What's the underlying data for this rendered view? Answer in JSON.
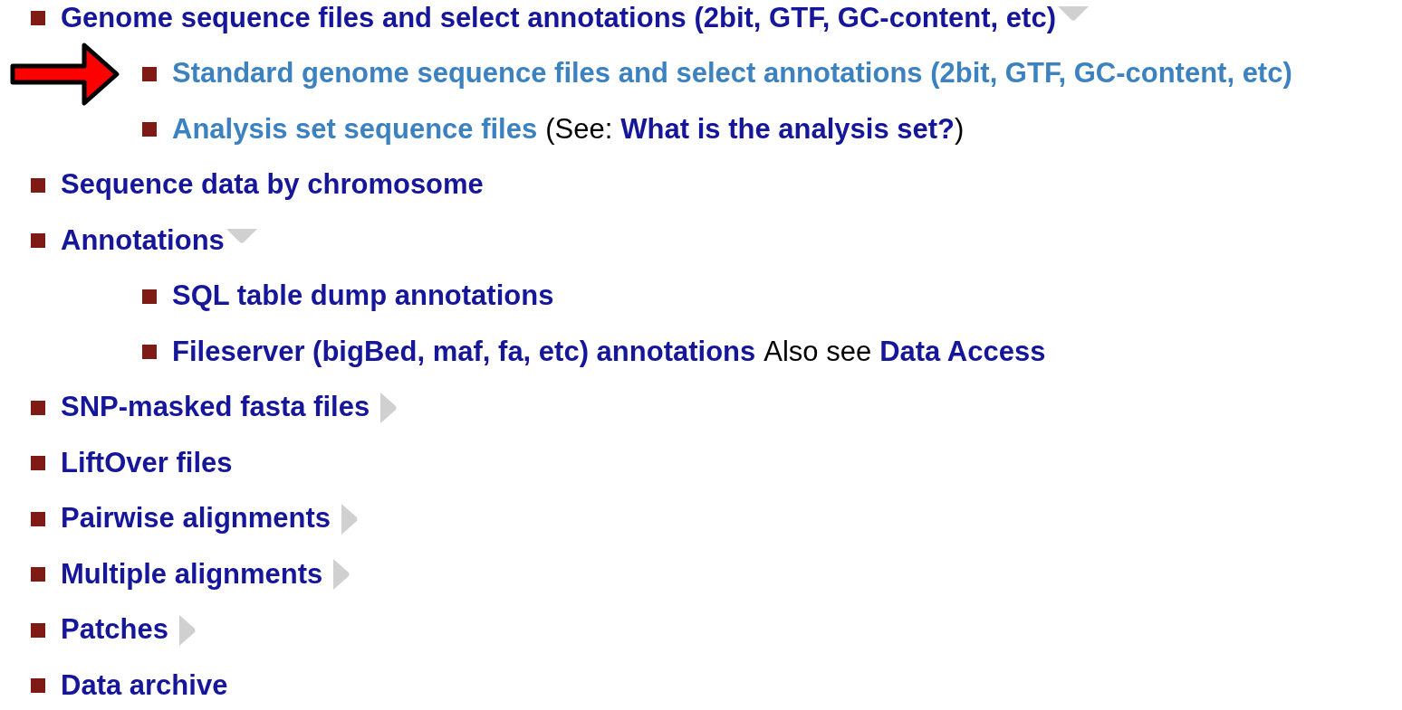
{
  "items": [
    {
      "label": "Genome sequence files and select annotations (2bit, GTF, GC-content, etc)",
      "visited": false,
      "expanded": true,
      "children": [
        {
          "label": "Standard genome sequence files and select annotations (2bit, GTF, GC-content, etc)",
          "visited": true,
          "pointed_at": true
        },
        {
          "label": "Analysis set sequence files",
          "visited": true,
          "suffix": [
            {
              "kind": "text",
              "text": "(See: "
            },
            {
              "kind": "link",
              "text": "What is the analysis set?"
            },
            {
              "kind": "text",
              "text": ")"
            }
          ]
        }
      ]
    },
    {
      "label": "Sequence data by chromosome",
      "visited": false
    },
    {
      "label": "Annotations",
      "visited": false,
      "expanded": true,
      "children": [
        {
          "label": "SQL table dump annotations",
          "visited": false
        },
        {
          "label": "Fileserver (bigBed, maf, fa, etc) annotations",
          "visited": false,
          "suffix": [
            {
              "kind": "text",
              "text": "Also see "
            },
            {
              "kind": "link",
              "text": "Data Access"
            }
          ]
        }
      ]
    },
    {
      "label": "SNP-masked fasta files",
      "visited": false,
      "expanded": false
    },
    {
      "label": "LiftOver files",
      "visited": false
    },
    {
      "label": "Pairwise alignments",
      "visited": false,
      "expanded": false
    },
    {
      "label": "Multiple alignments",
      "visited": false,
      "expanded": false
    },
    {
      "label": "Patches",
      "visited": false,
      "expanded": false
    },
    {
      "label": "Data archive",
      "visited": false
    }
  ]
}
